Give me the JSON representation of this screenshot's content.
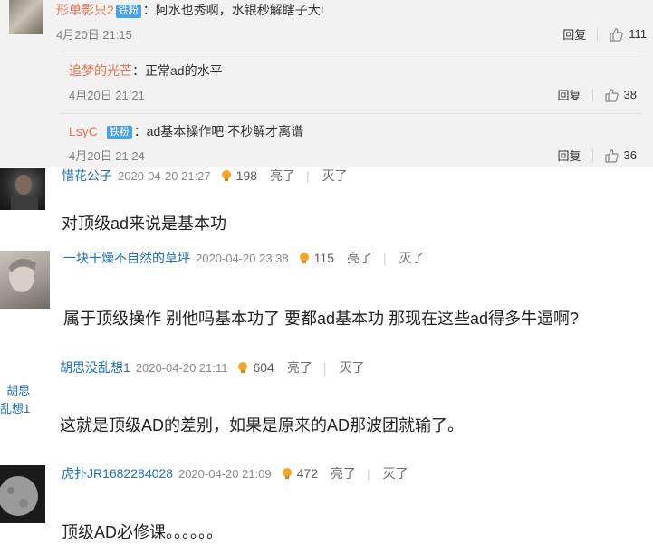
{
  "weibo": {
    "main": {
      "name": "形单影只2",
      "badge": "铁粉",
      "text": "：阿水也秀啊，水银秒解瞎子大!",
      "time": "4月20日 21:15",
      "reply": "回复",
      "likes": "111"
    },
    "replies": [
      {
        "name": "追梦的光芒",
        "badge": "",
        "text": "：正常ad的水平",
        "time": "4月20日 21:21",
        "reply": "回复",
        "likes": "38"
      },
      {
        "name": "LsyC_",
        "badge": "铁粉",
        "text": "：ad基本操作吧 不秒解才离谱",
        "time": "4月20日 21:24",
        "reply": "回复",
        "likes": "36"
      }
    ]
  },
  "comments": [
    {
      "user": "惜花公子",
      "date": "2020-04-20 21:27",
      "lights": "198",
      "liang": "亮了",
      "mie": "灭了",
      "text": "对顶级ad来说是基本功",
      "avatar_label": ""
    },
    {
      "user": "一块干燥不自然的草坪",
      "date": "2020-04-20 23:38",
      "lights": "115",
      "liang": "亮了",
      "mie": "灭了",
      "text": "属于顶级操作 别他吗基本功了 要都ad基本功 那现在这些ad得多牛逼啊?",
      "avatar_label": ""
    },
    {
      "user": "胡思没乱想1",
      "date": "2020-04-20 21:11",
      "lights": "604",
      "liang": "亮了",
      "mie": "灭了",
      "text": "这就是顶级AD的差别，如果是原来的AD那波团就输了。",
      "avatar_label": "胡思\n乱想1"
    },
    {
      "user": "虎扑JR1682284028",
      "date": "2020-04-20 21:09",
      "lights": "472",
      "liang": "亮了",
      "mie": "灭了",
      "text": "顶级AD必修课。。。。。。",
      "avatar_label": ""
    }
  ],
  "colors": {
    "username": "#1d6fb8",
    "weibo_name": "#eb7350",
    "badge": "#4aa3e6",
    "bulb": "#f5a623"
  }
}
